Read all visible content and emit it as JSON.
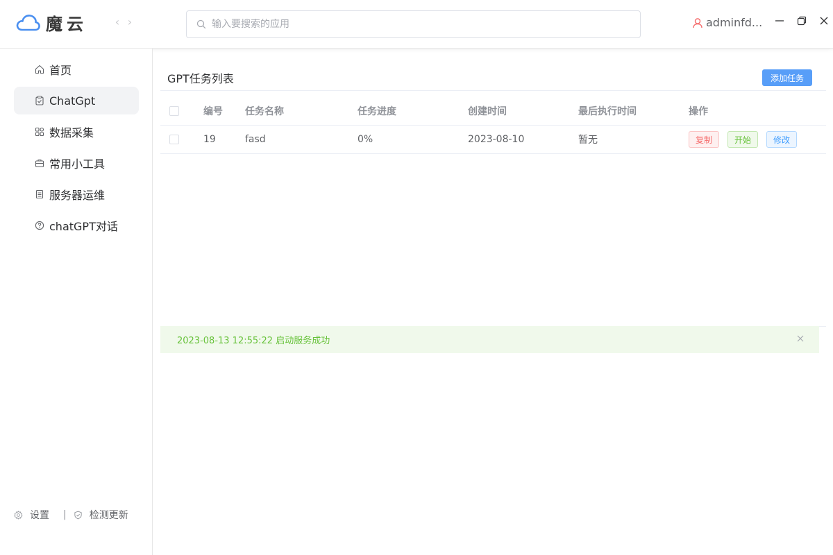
{
  "app": {
    "name": "魔云",
    "accent": "#589ef8"
  },
  "header": {
    "nav_back": "‹",
    "nav_forward": "›",
    "search_placeholder": "输入要搜索的应用",
    "user_name": "adminfd..."
  },
  "sidebar": {
    "items": [
      {
        "label": "首页",
        "icon": "home-icon"
      },
      {
        "label": "ChatGpt",
        "icon": "clipboard-icon"
      },
      {
        "label": "数据采集",
        "icon": "grid-icon"
      },
      {
        "label": "常用小工具",
        "icon": "briefcase-icon"
      },
      {
        "label": "服务器运维",
        "icon": "document-icon"
      },
      {
        "label": "chatGPT对话",
        "icon": "help-icon"
      }
    ],
    "active_index": 1,
    "footer": {
      "settings": "设置",
      "separator": "|",
      "check_update": "检测更新"
    }
  },
  "main": {
    "title": "GPT任务列表",
    "add_button": "添加任务",
    "table": {
      "headers": [
        "编号",
        "任务名称",
        "任务进度",
        "创建时间",
        "最后执行时间",
        "操作"
      ],
      "rows": [
        {
          "id": "19",
          "name": "fasd",
          "progress": "0%",
          "created": "2023-08-10",
          "last_run": "暂无",
          "actions": [
            "复制",
            "开始",
            "修改"
          ]
        }
      ]
    },
    "alert": {
      "message": "2023-08-13 12:55:22 启动服务成功",
      "color": "#67c23a"
    }
  },
  "colors": {
    "danger": "#f56c6c",
    "success": "#67c23a",
    "primary": "#409eff"
  }
}
